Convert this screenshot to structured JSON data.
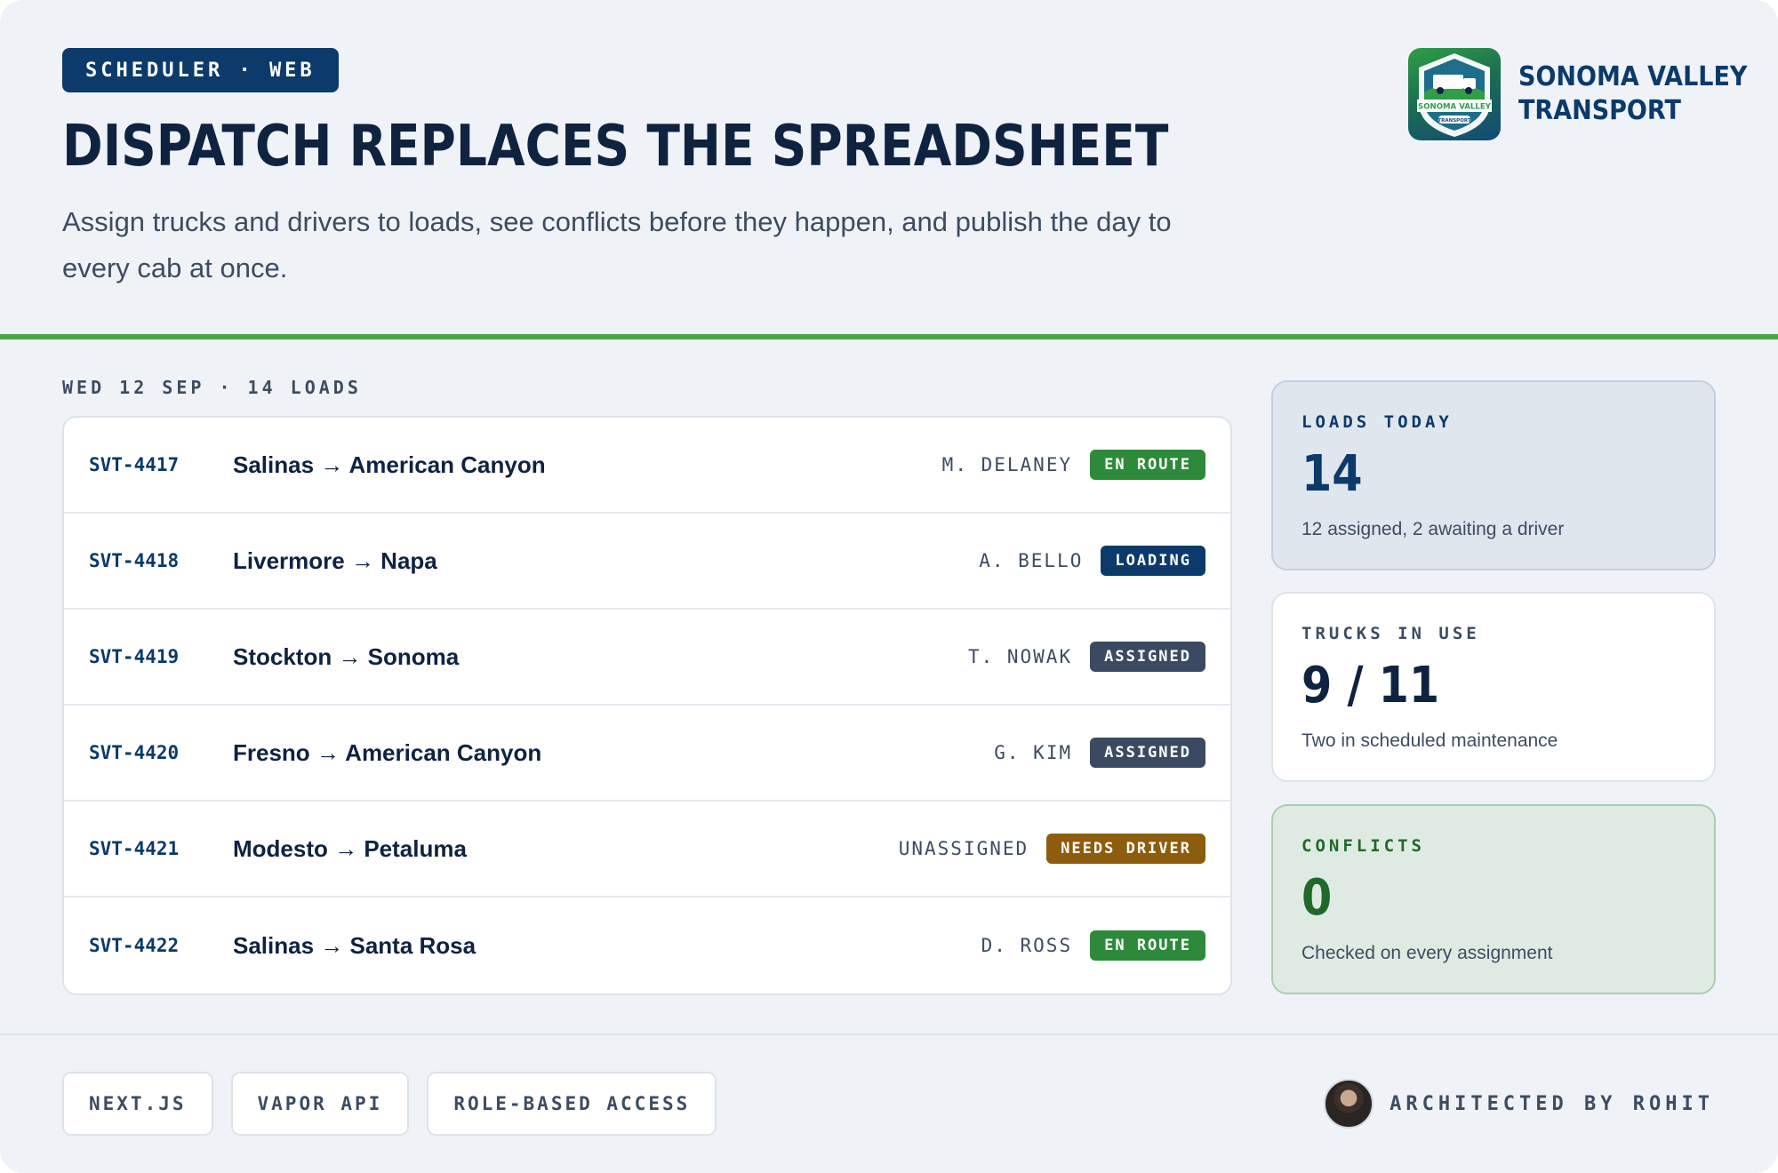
{
  "header": {
    "badge": "SCHEDULER · WEB",
    "title": "DISPATCH REPLACES THE SPREADSHEET",
    "subtitle": "Assign trucks and drivers to loads, see conflicts before they happen, and publish the day to every cab at once."
  },
  "brand": {
    "logo_text_main": "SONOMA VALLEY",
    "logo_text_sub": "TRANSPORT",
    "name_line1": "SONOMA VALLEY",
    "name_line2": "TRANSPORT"
  },
  "loads": {
    "date_label": "WED 12 SEP · 14 LOADS",
    "rows": [
      {
        "id": "SVT-4417",
        "route": "Salinas → American Canyon",
        "driver": "M. DELANEY",
        "status": "EN ROUTE",
        "status_kind": "enroute"
      },
      {
        "id": "SVT-4418",
        "route": "Livermore → Napa",
        "driver": "A. BELLO",
        "status": "LOADING",
        "status_kind": "loading"
      },
      {
        "id": "SVT-4419",
        "route": "Stockton → Sonoma",
        "driver": "T. NOWAK",
        "status": "ASSIGNED",
        "status_kind": "assigned"
      },
      {
        "id": "SVT-4420",
        "route": "Fresno → American Canyon",
        "driver": "G. KIM",
        "status": "ASSIGNED",
        "status_kind": "assigned"
      },
      {
        "id": "SVT-4421",
        "route": "Modesto → Petaluma",
        "driver": "UNASSIGNED",
        "status": "NEEDS DRIVER",
        "status_kind": "needs"
      },
      {
        "id": "SVT-4422",
        "route": "Salinas → Santa Rosa",
        "driver": "D. ROSS",
        "status": "EN ROUTE",
        "status_kind": "enroute"
      }
    ]
  },
  "stats": {
    "loads_today": {
      "label": "LOADS TODAY",
      "value": "14",
      "note": "12 assigned, 2 awaiting a driver"
    },
    "trucks": {
      "label": "TRUCKS IN USE",
      "value": "9 / 11",
      "note": "Two in scheduled maintenance"
    },
    "conflicts": {
      "label": "CONFLICTS",
      "value": "0",
      "note": "Checked on every assignment"
    }
  },
  "footer": {
    "tags": [
      "NEXT.JS",
      "VAPOR API",
      "ROLE-BASED ACCESS"
    ],
    "credit": "ARCHITECTED BY ROHIT"
  },
  "colors": {
    "navy": "#0b3a6b",
    "accent_green": "#4aa544",
    "en_route": "#2d8a3a",
    "loading": "#0b3a6b",
    "assigned": "#3b4a62",
    "needs_driver": "#8d5c0d",
    "background": "#eff3f8"
  }
}
